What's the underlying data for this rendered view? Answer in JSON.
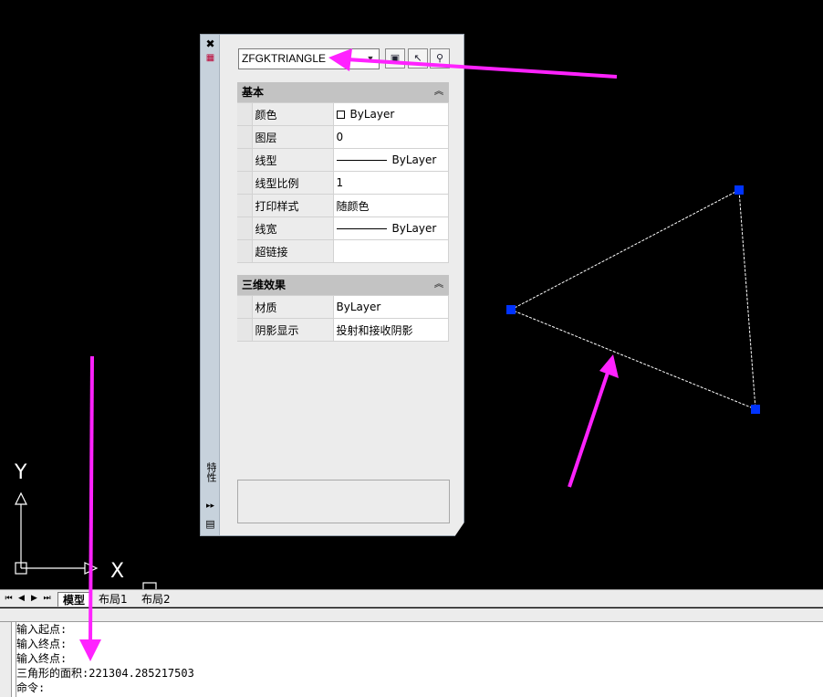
{
  "palette": {
    "object_type": "ZFGKTRIANGLE",
    "strip_title": "特性",
    "sections": [
      {
        "title": "基本",
        "rows": [
          {
            "name": "颜色",
            "value": "ByLayer",
            "kind": "color"
          },
          {
            "name": "图层",
            "value": "0",
            "kind": "text"
          },
          {
            "name": "线型",
            "value": "ByLayer",
            "kind": "line"
          },
          {
            "name": "线型比例",
            "value": "1",
            "kind": "text"
          },
          {
            "name": "打印样式",
            "value": "随颜色",
            "kind": "text"
          },
          {
            "name": "线宽",
            "value": "ByLayer",
            "kind": "line"
          },
          {
            "name": "超链接",
            "value": "",
            "kind": "text"
          }
        ]
      },
      {
        "title": "三维效果",
        "rows": [
          {
            "name": "材质",
            "value": "ByLayer",
            "kind": "text"
          },
          {
            "name": "阴影显示",
            "value": "投射和接收阴影",
            "kind": "text"
          }
        ]
      }
    ]
  },
  "canvas": {
    "axis_x": "X",
    "axis_y": "Y",
    "grip_color": "#0033ff",
    "annotation_color": "#ff22ff"
  },
  "tabs": {
    "items": [
      {
        "label": "模型",
        "active": true
      },
      {
        "label": "布局1",
        "active": false
      },
      {
        "label": "布局2",
        "active": false
      }
    ]
  },
  "command_history": [
    "输入起点:",
    "输入终点:",
    "输入终点:",
    "三角形的面积:221304.285217503",
    "命令:"
  ]
}
